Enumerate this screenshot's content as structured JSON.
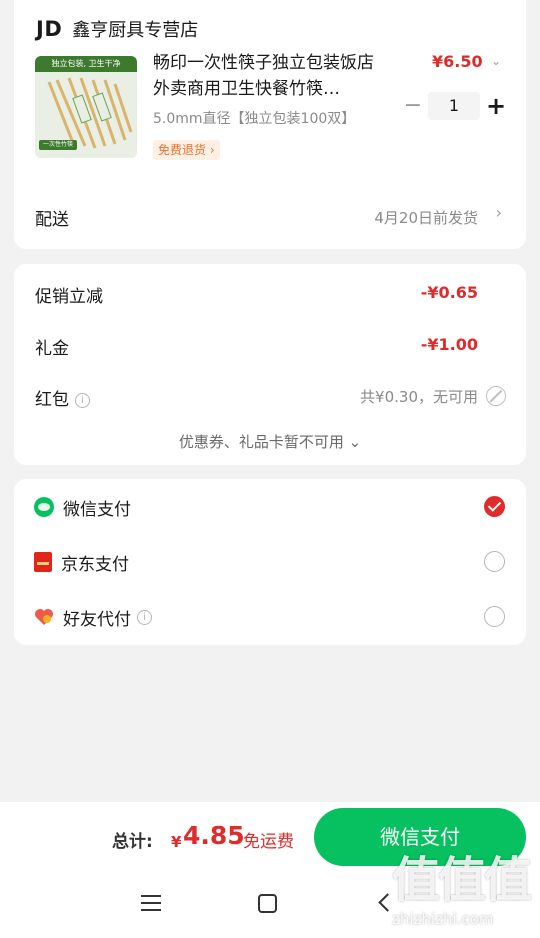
{
  "store": {
    "logo": "JD",
    "name": "鑫亨厨具专营店"
  },
  "product": {
    "image_top_text": "独立包装, 卫生干净",
    "image_bottom_text": "一次性竹筷",
    "title": "畅印一次性筷子独立包装饭店外卖商用卫生快餐竹筷…",
    "spec": "5.0mm直径【独立包装100双】",
    "return_badge": "免费退货 ›",
    "price": "¥6.50",
    "quantity": "1"
  },
  "shipping": {
    "label": "配送",
    "value": "4月20日前发货"
  },
  "discounts": {
    "promo_label": "促销立减",
    "promo_value": "-¥0.65",
    "gift_label": "礼金",
    "gift_value": "-¥1.00",
    "redpacket_label": "红包",
    "redpacket_value": "共¥0.30，无可用",
    "coupon_note": "优惠券、礼品卡暂不可用 ⌄"
  },
  "payment_methods": [
    {
      "label": "微信支付",
      "icon": "wechat-icon",
      "selected": true
    },
    {
      "label": "京东支付",
      "icon": "jdpay-icon",
      "selected": false
    },
    {
      "label": "好友代付",
      "icon": "friend-pay-icon",
      "selected": false
    }
  ],
  "footer": {
    "total_label": "总计:",
    "currency": "¥",
    "total_amount": "4.85",
    "free_shipping": "免运费",
    "pay_button": "微信支付"
  },
  "watermark": {
    "big": "值值值",
    "small": "zhizhizhi.com"
  },
  "colors": {
    "accent_green": "#07c160",
    "price_red": "#e12b2b",
    "badge_orange": "#f0702b"
  }
}
